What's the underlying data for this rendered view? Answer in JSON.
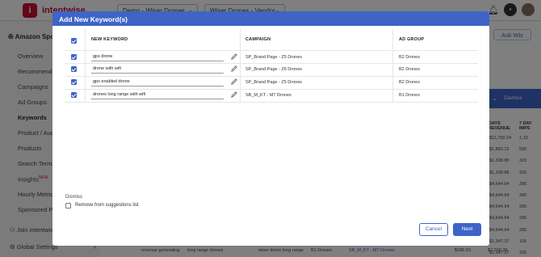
{
  "app": {
    "logo_letter": "i",
    "brand": "intentwise",
    "brand_suffix": "ntwise",
    "profile_selector": "Demo - Wiser Drones",
    "account_selector": "Wiser Drones - Vendor"
  },
  "sidebar": {
    "section": "Amazon Sponsored",
    "items": [
      {
        "label": "Overview"
      },
      {
        "label": "Recommendations"
      },
      {
        "label": "Campaigns"
      },
      {
        "label": "Ad Groups"
      },
      {
        "label": "Keywords",
        "active": true
      },
      {
        "label": "Product / Audience"
      },
      {
        "label": "Products"
      },
      {
        "label": "Search Terms"
      },
      {
        "label": "Insights",
        "badge": "NEW"
      },
      {
        "label": "Hourly Metrics"
      },
      {
        "label": "Sponsored Prod..."
      }
    ],
    "footer": {
      "join": "Join intentwise",
      "settings": "Global Settings"
    }
  },
  "main": {
    "ask_wiz": "Ask Wiz",
    "dismiss_menu": "Dismiss",
    "col_days_revenue": "DAYS REVENUE",
    "col_7day_imps": "7 DAY IMPS",
    "revenue_values": [
      "$11,700.24",
      "$1,850.12",
      "$1,308.88",
      "$1,308.88",
      "$4,644.94",
      "$4,644.94",
      "$4,644.94",
      "$4,644.94",
      "$4,644.94",
      "$1,347.37",
      "$1,347.37",
      "$2,290.39"
    ],
    "imps_values": [
      "1,19",
      "595",
      "320",
      "320",
      "286",
      "286",
      "286",
      "286",
      "286",
      "106",
      "106",
      "1,29"
    ],
    "bottom_row": {
      "match": "revenue generating",
      "term": "long range drones",
      "keyword": "wiser drone long range",
      "adgroup": "B1 Drones",
      "campaign": "SB_M_KT - M7 Drones",
      "revenue": "$186.93",
      "value": "$2,290.39"
    }
  },
  "modal": {
    "title": "Add New Keyword(s)",
    "headers": {
      "keyword": "NEW KEYWORD",
      "campaign": "CAMPAIGN",
      "adgroup": "AD GROUP"
    },
    "rows": [
      {
        "keyword": "gps drone",
        "campaign": "SP_Brand Page - Z5 Drones",
        "adgroup": "B2 Drones"
      },
      {
        "keyword": "drone with wifi",
        "campaign": "SP_Brand Page - Z6 Drones",
        "adgroup": "B2 Drones"
      },
      {
        "keyword": "gps enabled drone",
        "campaign": "SP_Brand Page - Z5 Drones",
        "adgroup": "B2 Drones"
      },
      {
        "keyword": "drones long range with wifi",
        "campaign": "SB_M_KT - M7 Drones",
        "adgroup": "B1 Drones"
      }
    ],
    "dismiss_label": "Dismiss",
    "remove_label": "Remove from suggestions list",
    "cancel": "Cancel",
    "next": "Next"
  },
  "colors": {
    "accent": "#3e64c8",
    "brand": "#c8102e"
  }
}
